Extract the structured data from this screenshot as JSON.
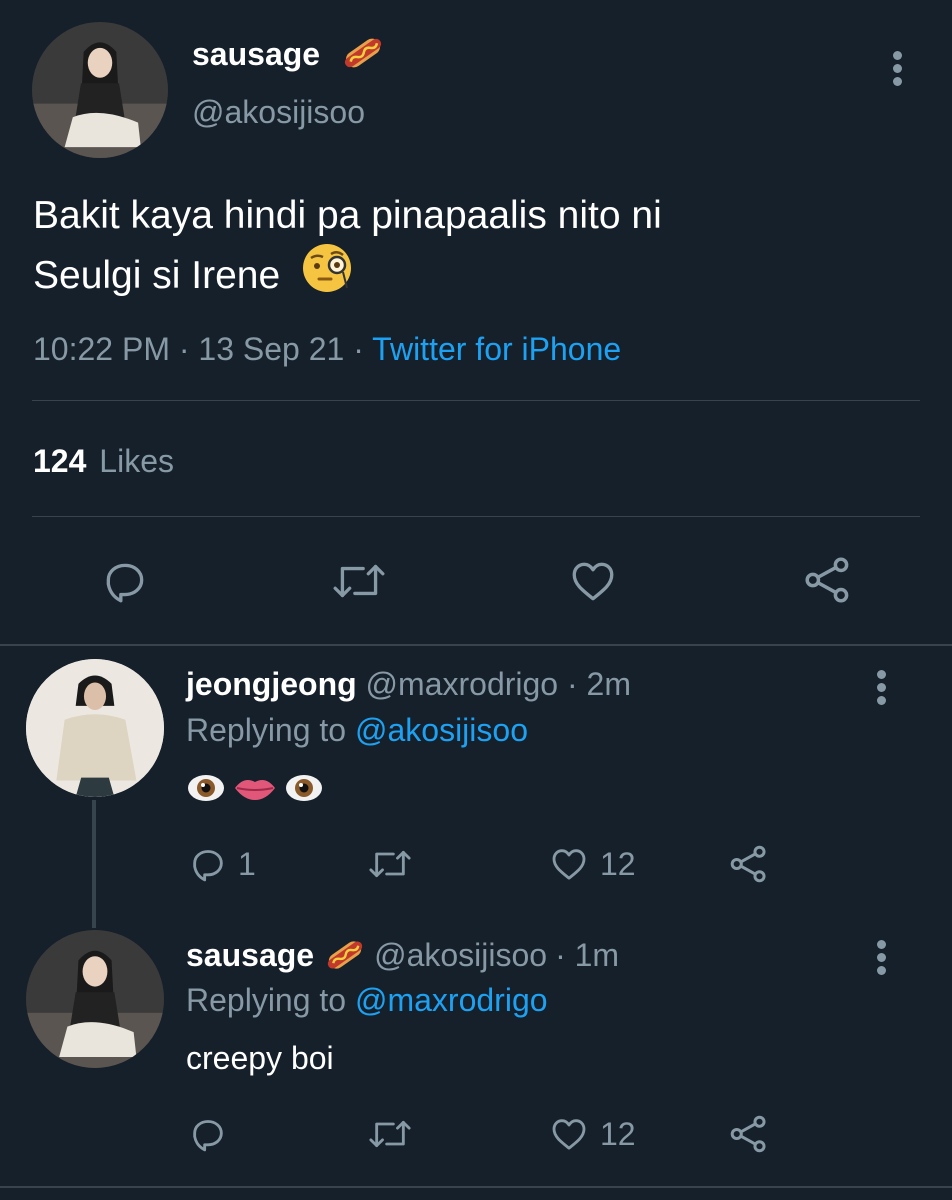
{
  "main_tweet": {
    "display_name": "sausage",
    "name_emoji": "hot-dog-emoji",
    "handle": "@akosijisoo",
    "text_line1": "Bakit kaya hindi pa pinapaalis nito ni",
    "text_line2": "Seulgi si Irene",
    "text_emoji": "face-with-monocle-emoji",
    "time": "10:22 PM",
    "sep1": "·",
    "date": "13 Sep 21",
    "sep2": "·",
    "source": "Twitter for iPhone",
    "likes_count": "124",
    "likes_label": "Likes"
  },
  "replies": [
    {
      "display_name": "jeongjeong",
      "handle": "@maxrodrigo",
      "age": "· 2m",
      "replying_label": "Replying to",
      "replying_to": "@akosijisoo",
      "emojis": [
        "eye-emoji",
        "lips-emoji",
        "eye-emoji"
      ],
      "reply_count": "1",
      "like_count": "12"
    },
    {
      "display_name": "sausage",
      "name_emoji": "hot-dog-emoji",
      "handle": "@akosijisoo",
      "age": "· 1m",
      "replying_label": "Replying to",
      "replying_to": "@maxrodrigo",
      "text": "creepy boi",
      "reply_count": "",
      "like_count": "12"
    }
  ],
  "colors": {
    "background": "#15202b",
    "muted": "#8899a6",
    "link": "#1da1f2",
    "divider": "#38444d"
  }
}
